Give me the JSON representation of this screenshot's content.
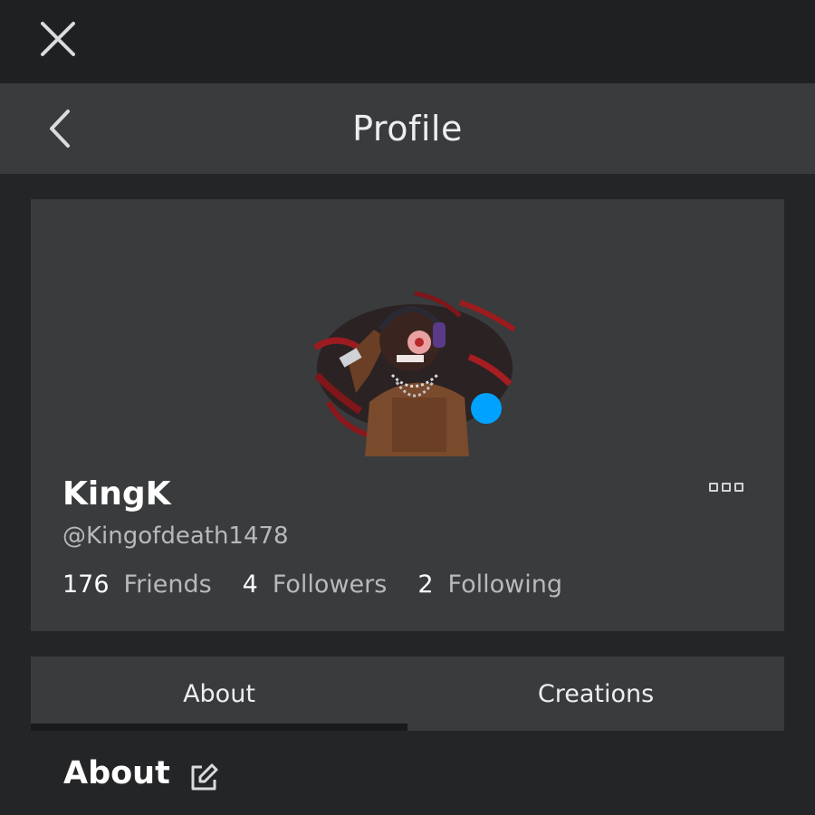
{
  "header": {
    "title": "Profile"
  },
  "profile": {
    "display_name": "KingK",
    "username": "@Kingofdeath1478",
    "presence_color": "#00a2ff",
    "stats": [
      {
        "count": "176",
        "label": "Friends"
      },
      {
        "count": "4",
        "label": "Followers"
      },
      {
        "count": "2",
        "label": "Following"
      }
    ]
  },
  "tabs": [
    {
      "label": "About",
      "active": true
    },
    {
      "label": "Creations",
      "active": false
    }
  ],
  "about": {
    "title": "About"
  },
  "icons": {
    "close": "close-icon",
    "back": "chevron-left-icon",
    "more": "more-options-icon",
    "edit": "edit-icon"
  }
}
